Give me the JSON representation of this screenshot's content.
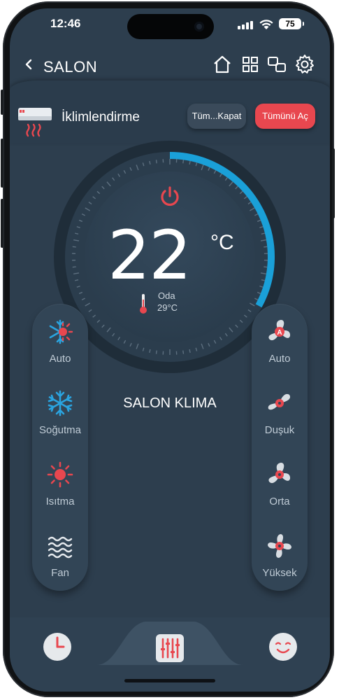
{
  "status_bar": {
    "time": "12:46",
    "battery": "75"
  },
  "header": {
    "title": "SALON"
  },
  "section": {
    "title": "İklimlendirme",
    "all_off_label": "Tüm...Kapat",
    "all_on_label": "Tümünü Aç"
  },
  "thermostat": {
    "set_temperature": "22",
    "unit": "°C",
    "room_label": "Oda",
    "room_temperature": "29°C",
    "level_fraction": 0.33
  },
  "device_name": "SALON KLIMA",
  "modes": [
    {
      "label": "Auto",
      "icon": "auto-mode-icon"
    },
    {
      "label": "Soğutma",
      "icon": "snowflake-icon"
    },
    {
      "label": "Isıtma",
      "icon": "sun-icon"
    },
    {
      "label": "Fan",
      "icon": "wind-waves-icon"
    }
  ],
  "fan_speeds": [
    {
      "label": "Auto",
      "icon": "fan-auto-icon"
    },
    {
      "label": "Duşuk",
      "icon": "fan-low-icon"
    },
    {
      "label": "Orta",
      "icon": "fan-medium-icon"
    },
    {
      "label": "Yüksek",
      "icon": "fan-high-icon"
    }
  ],
  "colors": {
    "accent_red": "#e8474f",
    "accent_blue": "#1aa0d8",
    "background": "#2d3e4e"
  }
}
